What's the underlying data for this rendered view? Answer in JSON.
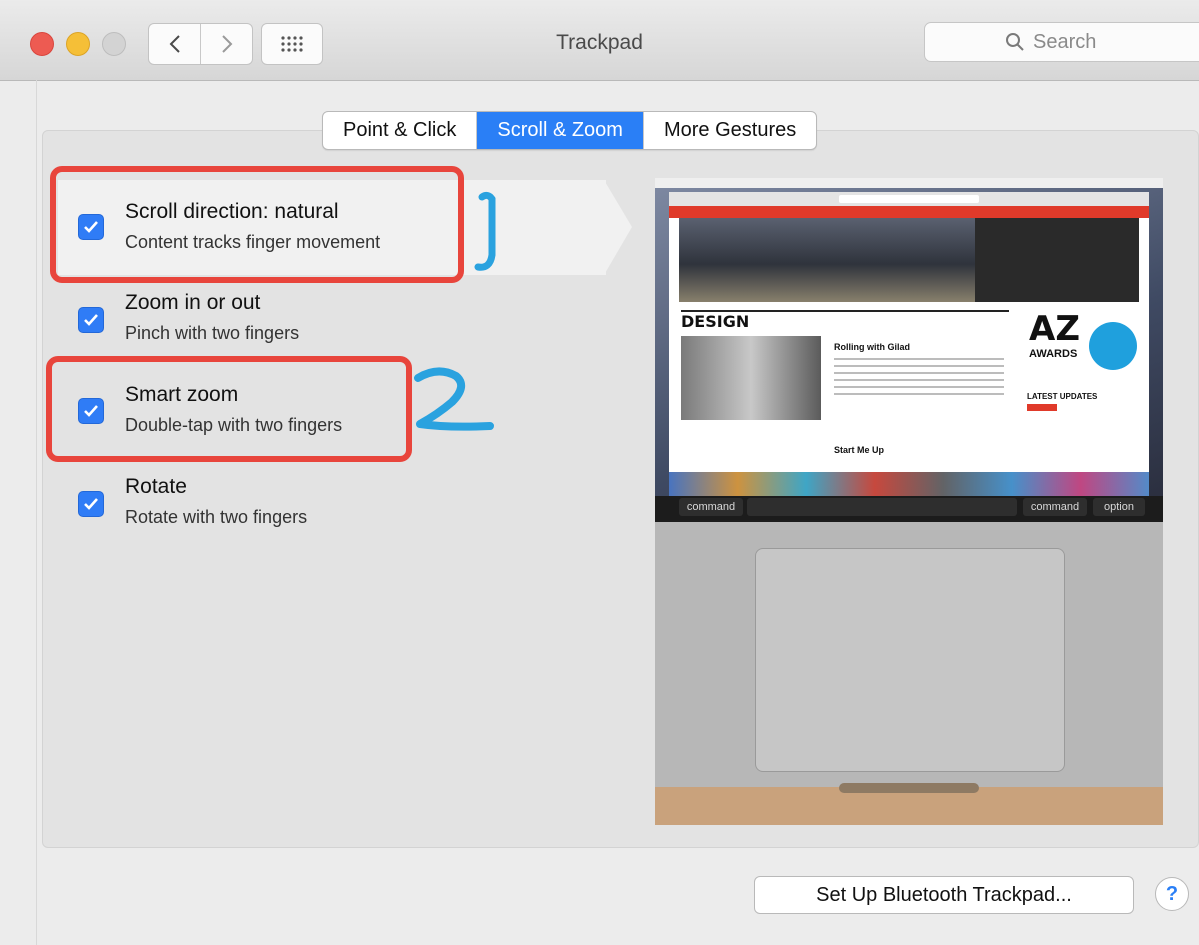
{
  "window": {
    "title": "Trackpad",
    "search_placeholder": "Search"
  },
  "tabs": [
    {
      "label": "Point & Click",
      "active": false
    },
    {
      "label": "Scroll & Zoom",
      "active": true
    },
    {
      "label": "More Gestures",
      "active": false
    }
  ],
  "options": [
    {
      "title": "Scroll direction: natural",
      "subtitle": "Content tracks finger movement",
      "checked": true
    },
    {
      "title": "Zoom in or out",
      "subtitle": "Pinch with two fingers",
      "checked": true
    },
    {
      "title": "Smart zoom",
      "subtitle": "Double-tap with two fingers",
      "checked": true
    },
    {
      "title": "Rotate",
      "subtitle": "Rotate with two fingers",
      "checked": true
    }
  ],
  "annotations": {
    "mark1": "1",
    "mark2": "2",
    "box_color": "#e8453c",
    "mark_color": "#2aa2df"
  },
  "preview": {
    "section_heading": "DESIGN",
    "article_title": "Rolling with Gilad",
    "article2_title": "Start Me Up",
    "az": "AZ",
    "awards": "AWARDS",
    "latest_updates": "LATEST UPDATES",
    "key_command_left": "command",
    "key_command_right": "command",
    "key_option": "option"
  },
  "footer": {
    "setup_button": "Set Up Bluetooth Trackpad...",
    "help_button": "?"
  },
  "colors": {
    "accent": "#2a7ff6"
  }
}
